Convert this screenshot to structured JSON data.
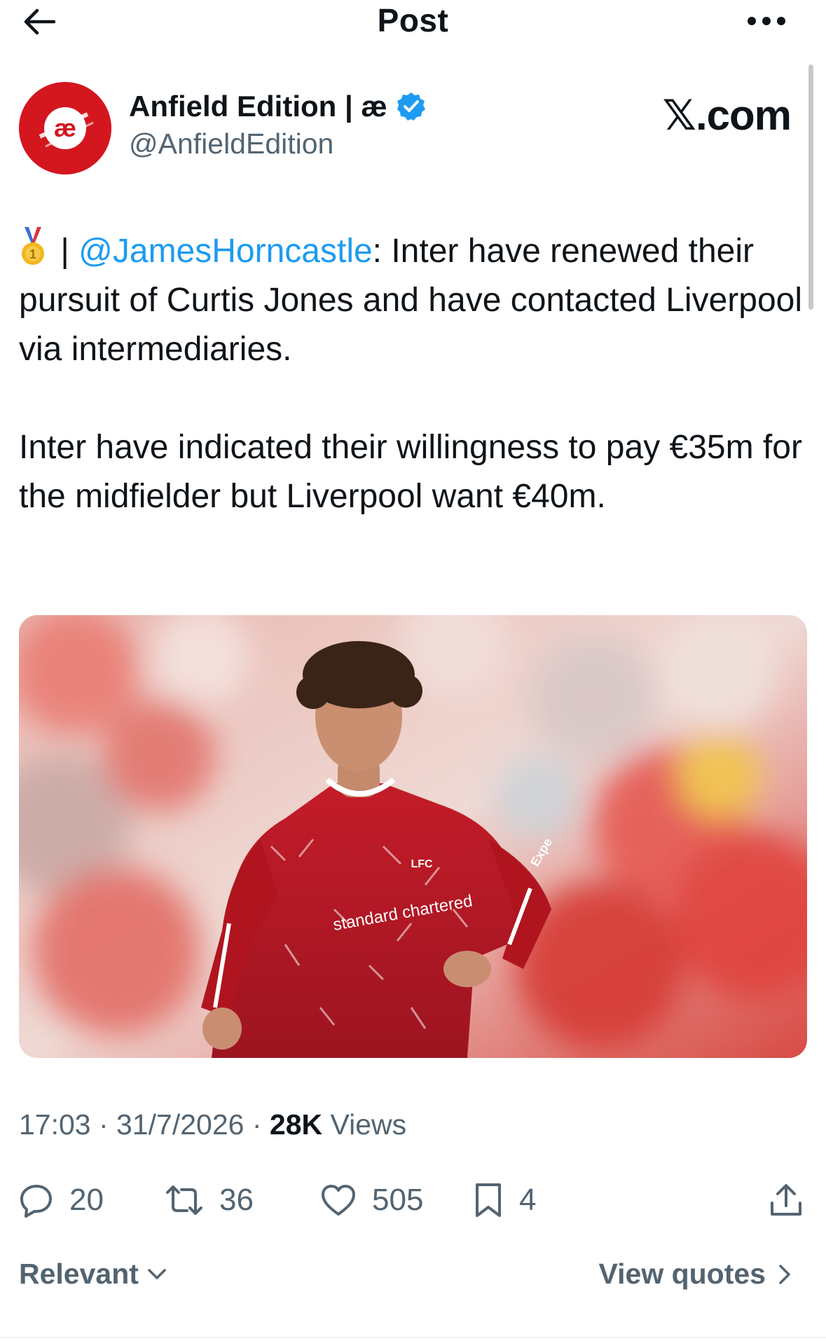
{
  "header": {
    "title": "Post",
    "back_icon": "arrow-left-icon",
    "more_icon": "more-horizontal-icon"
  },
  "author": {
    "display_name": "Anfield Edition | æ",
    "handle": "@AnfieldEdition",
    "verified": true,
    "avatar_text": "æ",
    "avatar_color": "#d4161f",
    "verified_color": "#1d9bf0"
  },
  "source_mark": "𝕏.com",
  "tweet": {
    "emoji": "🥇",
    "separator": " | ",
    "mention": "@JamesHorncastle",
    "line1_rest": ": Inter have renewed their pursuit of Curtis Jones and have contacted Liverpool via intermediaries.",
    "paragraph2": "Inter have indicated their willingness to pay €35m for the midfielder but Liverpool want €40m."
  },
  "media": {
    "sponsor_text": "standard chartered",
    "crest_text": "LFC",
    "sleeve_text": "Expe"
  },
  "meta": {
    "time": "17:03",
    "dot": " · ",
    "date": "31/7/2026",
    "views_count": "28K",
    "views_label": "Views"
  },
  "actions": {
    "replies": "20",
    "reposts": "36",
    "likes": "505",
    "bookmarks": "4"
  },
  "footer": {
    "sort_label": "Relevant",
    "view_quotes_label": "View quotes"
  },
  "colors": {
    "text_primary": "#0f1419",
    "text_secondary": "#536471",
    "link": "#1d9bf0",
    "jersey_red": "#b0151f"
  }
}
